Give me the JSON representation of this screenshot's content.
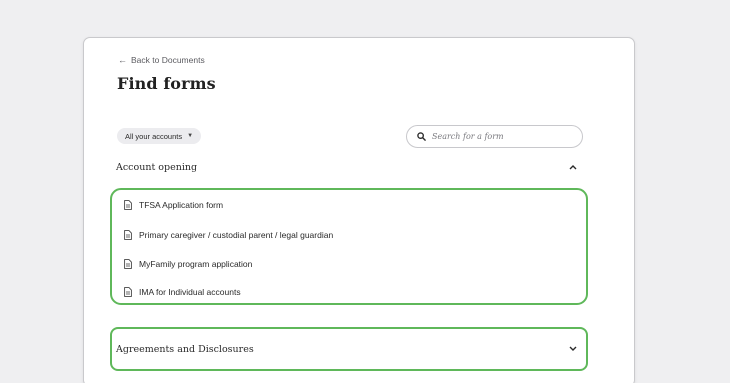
{
  "header": {
    "back_link": "Back to Documents",
    "title": "Find forms"
  },
  "filters": {
    "accounts_label": "All your accounts",
    "search_placeholder": "Search for a form"
  },
  "sections": {
    "account_opening": {
      "title": "Account opening",
      "expanded": true,
      "forms": [
        "TFSA Application form",
        "Primary caregiver / custodial parent / legal guardian",
        "MyFamily program application",
        "IMA for Individual accounts"
      ]
    },
    "agreements": {
      "title": "Agreements and Disclosures",
      "expanded": false
    }
  },
  "colors": {
    "highlight": "#5fb85a",
    "background": "#efeff1"
  },
  "icons": {
    "back": "arrow-left-icon",
    "filter_caret": "caret-down-icon",
    "search": "search-icon",
    "form": "document-icon",
    "collapse": "chevron-up-icon",
    "expand": "chevron-down-icon"
  }
}
